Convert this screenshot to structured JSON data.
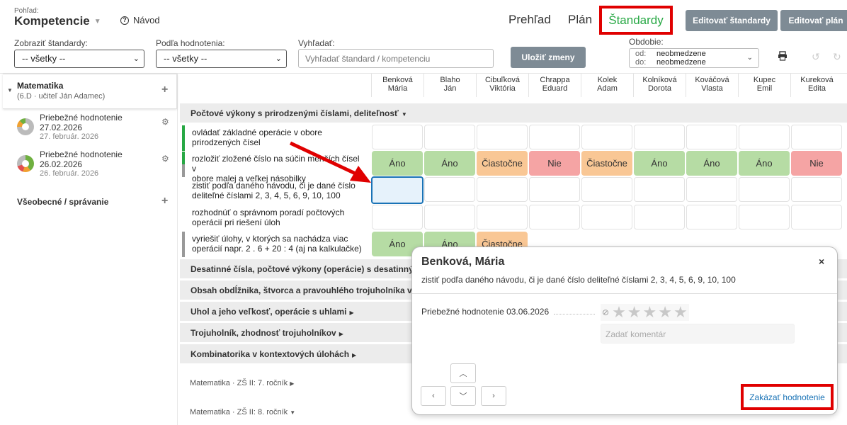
{
  "header": {
    "view_label": "Pohľad:",
    "view_title": "Kompetencie",
    "help_label": "Návod",
    "nav": {
      "prehlad": "Prehľad",
      "plan": "Plán",
      "standardy": "Štandardy"
    },
    "edit_standards": "Editovať štandardy",
    "edit_plan": "Editovať plán"
  },
  "filters": {
    "show_label": "Zobraziť štandardy:",
    "show_value": "-- všetky --",
    "rating_label": "Podľa hodnotenia:",
    "rating_value": "-- všetky --",
    "search_label": "Vyhľadať:",
    "search_placeholder": "Vyhľadať štandard / kompetenciu",
    "save_label": "Uložiť zmeny",
    "period_label": "Obdobie:",
    "period_from_key": "od:",
    "period_from": "neobmedzene",
    "period_to_key": "do:",
    "period_to": "neobmedzene"
  },
  "sidebar": {
    "subject": "Matematika",
    "subject_meta": "(6.D · učiteľ Ján Adamec)",
    "evaluations": [
      {
        "title": "Priebežné hodnotenie",
        "date": "27.02.2026",
        "date_long": "27. február. 2026"
      },
      {
        "title": "Priebežné hodnotenie",
        "date": "26.02.2026",
        "date_long": "26. február. 2026"
      }
    ],
    "section2": "Všeobecné / správanie"
  },
  "students": [
    {
      "last": "Benková",
      "first": "Mária"
    },
    {
      "last": "Blaho",
      "first": "Ján"
    },
    {
      "last": "Cibuľková",
      "first": "Viktória"
    },
    {
      "last": "Chrappa",
      "first": "Eduard"
    },
    {
      "last": "Kolek",
      "first": "Adam"
    },
    {
      "last": "Kolníková",
      "first": "Dorota"
    },
    {
      "last": "Kováčová",
      "first": "Vlasta"
    },
    {
      "last": "Kupec",
      "first": "Emil"
    },
    {
      "last": "Kureková",
      "first": "Edita"
    }
  ],
  "groups": [
    "Počtové výkony s prirodzenými číslami, deliteľnosť",
    "Desatinné čísla, počtové výkony (operácie) s desatinným",
    "Obsah obdĺžnika, štvorca a pravouhlého trojuholníka v",
    "Uhol a jeho veľkosť, operácie s uhlami",
    "Trojuholník, zhodnosť trojuholníkov",
    "Kombinatorika v kontextových úlohách"
  ],
  "standards": [
    {
      "line1": "ovládať základné operácie v obore",
      "line2": "prirodzených čísel",
      "cells": [
        "",
        "",
        "",
        "",
        "",
        "",
        "",
        "",
        ""
      ]
    },
    {
      "line1": "rozložiť zložené číslo na súčin menších čísel v",
      "line2": "obore malej a veľkej násobilky",
      "cells": [
        "Áno",
        "Áno",
        "Čiastočne",
        "Nie",
        "Čiastočne",
        "Áno",
        "Áno",
        "Áno",
        "Nie"
      ]
    },
    {
      "line1": "zistiť podľa daného návodu, či je dané číslo",
      "line2": "deliteľné číslami 2, 3, 4, 5, 6, 9, 10, 100",
      "cells": [
        "",
        "",
        "",
        "",
        "",
        "",
        "",
        "",
        ""
      ]
    },
    {
      "line1": "rozhodnúť o správnom poradí počtových",
      "line2": "operácií pri riešení úloh",
      "cells": [
        "",
        "",
        "",
        "",
        "",
        "",
        "",
        "",
        ""
      ]
    },
    {
      "line1": "vyriešiť úlohy, v ktorých sa nachádza viac",
      "line2": "operácií napr. 2 . 6 + 20 : 4 (aj na kalkulačke)",
      "cells": [
        "Áno",
        "Áno",
        "Čiastočne",
        "",
        "",
        "",
        "",
        "",
        ""
      ]
    }
  ],
  "footer_links": [
    {
      "subject": "Matematika",
      "sep": "·",
      "grade": "ZŠ II: 7. ročník"
    },
    {
      "subject": "Matematika",
      "sep": "·",
      "grade": "ZŠ II: 8. ročník"
    }
  ],
  "popup": {
    "student": "Benková, Mária",
    "standard": "zistiť podľa daného návodu, či je dané číslo deliteľné číslami 2, 3, 4, 5, 6, 9, 10, 100",
    "evaluation": "Priebežné hodnotenie 03.06.2026",
    "comment_placeholder": "Zadať komentár",
    "disable_label": "Zakázať hodnotenie"
  },
  "colors": {
    "ano": "#b6dca4",
    "ciastocne": "#f9c795",
    "nie": "#f5a4a4",
    "highlight_red": "#e00000",
    "accent_green": "#27a844",
    "button_grey": "#7e8b95"
  }
}
